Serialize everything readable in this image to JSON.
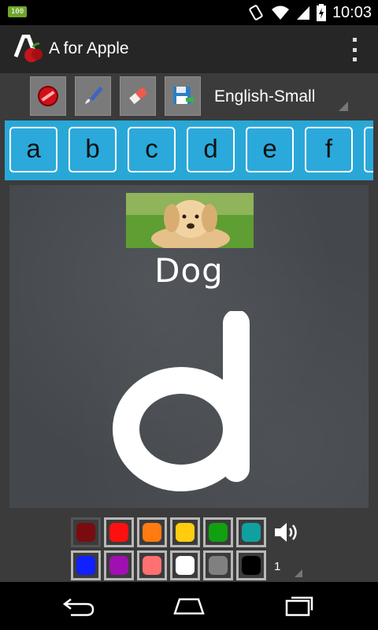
{
  "status_bar": {
    "time": "10:03",
    "app_badge": "100",
    "icons": [
      "notification-badge-icon",
      "rotate-icon",
      "wifi-icon",
      "signal-icon",
      "battery-icon"
    ]
  },
  "action_bar": {
    "title": "A for Apple",
    "icons": [
      "app-logo-icon",
      "overflow-menu-icon"
    ]
  },
  "toolbar": {
    "buttons": [
      "clear-icon",
      "brush-icon",
      "eraser-icon",
      "save-icon"
    ],
    "language": "English-Small"
  },
  "letters": [
    "a",
    "b",
    "c",
    "d",
    "e",
    "f"
  ],
  "board": {
    "word": "Dog",
    "letter": "d",
    "picture": "dog-photo"
  },
  "palette": {
    "row1": [
      "#7a0c10",
      "#ff1010",
      "#ff7a10",
      "#ffcc10",
      "#10a010",
      "#10a0a0"
    ],
    "row2": [
      "#1020ff",
      "#a010b0",
      "#ff7070",
      "#ffffff",
      "#808080",
      "#000000"
    ],
    "brush_size": "1",
    "sound_icon": "speaker-icon"
  },
  "nav_bar": {
    "icons": [
      "back-icon",
      "home-icon",
      "recents-icon"
    ]
  }
}
